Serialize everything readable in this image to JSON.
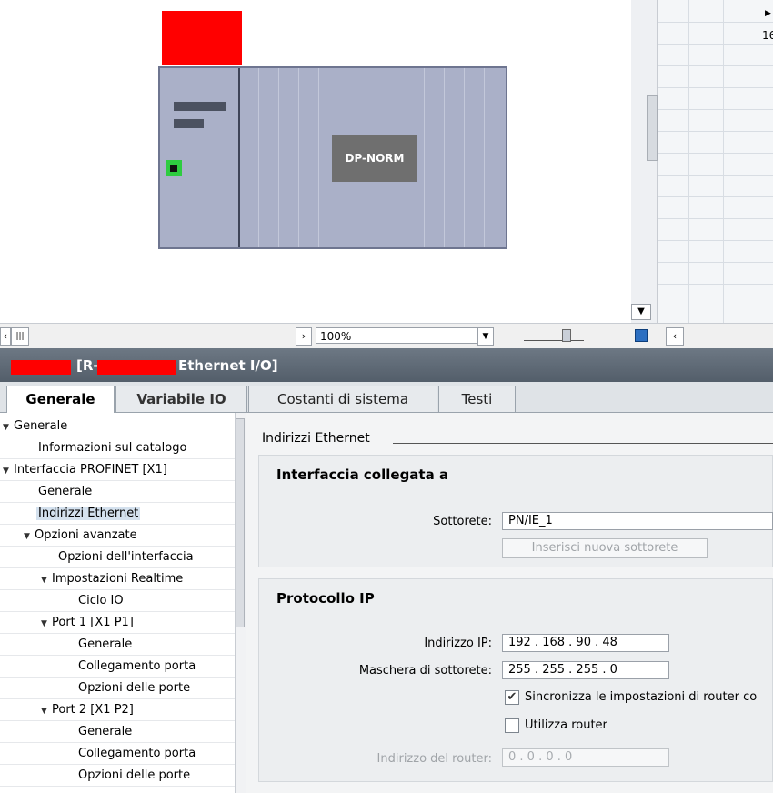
{
  "canvas": {
    "device_module_label": "DP-NORM"
  },
  "grid": {
    "number_fragment": "16"
  },
  "toolbar": {
    "scroll_left_glyph": "‹",
    "scroll_thumb_glyph": "|||",
    "scroll_right_glyph": "›",
    "zoom_value": "100%",
    "zoom_dropdown_glyph": "▼"
  },
  "inspector": {
    "title_prefix": "[R-",
    "title_suffix": "Ethernet I/O]"
  },
  "tabs": [
    {
      "label": "Generale"
    },
    {
      "label": "Variabile IO"
    },
    {
      "label": "Costanti di sistema"
    },
    {
      "label": "Testi"
    }
  ],
  "nav": {
    "items": [
      {
        "label": "Generale"
      },
      {
        "label": "Informazioni sul catalogo"
      },
      {
        "label": "Interfaccia PROFINET [X1]"
      },
      {
        "label": "Generale"
      },
      {
        "label": "Indirizzi Ethernet"
      },
      {
        "label": "Opzioni avanzate"
      },
      {
        "label": "Opzioni dell'interfaccia"
      },
      {
        "label": "Impostazioni Realtime"
      },
      {
        "label": "Ciclo IO"
      },
      {
        "label": "Port 1 [X1 P1]"
      },
      {
        "label": "Generale"
      },
      {
        "label": "Collegamento porta"
      },
      {
        "label": "Opzioni delle porte"
      },
      {
        "label": "Port 2 [X1 P2]"
      },
      {
        "label": "Generale"
      },
      {
        "label": "Collegamento porta"
      },
      {
        "label": "Opzioni delle porte"
      }
    ]
  },
  "props": {
    "section_title": "Indirizzi Ethernet",
    "interface": {
      "heading": "Interfaccia collegata a",
      "subnet_label": "Sottorete:",
      "subnet_value": "PN/IE_1",
      "add_subnet_button": "Inserisci nuova sottorete"
    },
    "ip": {
      "heading": "Protocollo IP",
      "ip_label": "Indirizzo IP:",
      "ip_value": "192 . 168 . 90  . 48",
      "mask_label": "Maschera di sottorete:",
      "mask_value": "255 . 255 . 255 . 0",
      "sync_router_label": "Sincronizza le impostazioni di router co",
      "sync_router_checked": true,
      "use_router_label": "Utilizza router",
      "use_router_checked": false,
      "router_address_label": "Indirizzo del router:",
      "router_address_value": "0    . 0    . 0    . 0"
    }
  },
  "colors": {
    "redaction": "#ff0000",
    "device_body": "#aab0c8",
    "title_bar": "#5f6a76",
    "port_icon": "#2ecc40"
  }
}
